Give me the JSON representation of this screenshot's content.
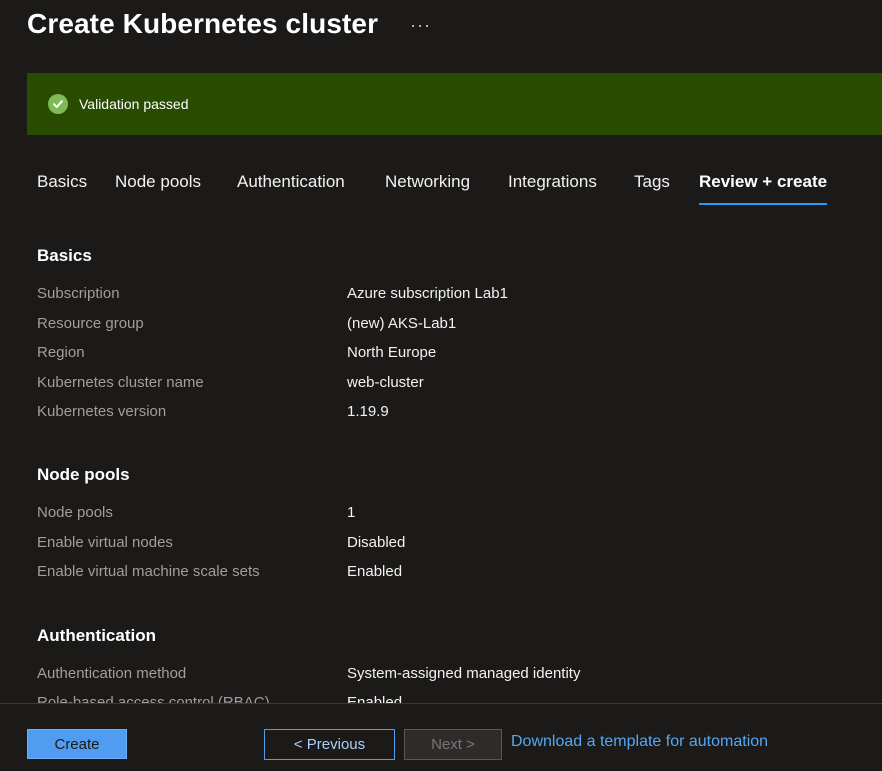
{
  "header": {
    "title": "Create Kubernetes cluster",
    "more": "···"
  },
  "validation": {
    "text": "Validation passed",
    "icon": "check-circle-icon",
    "color": "#294b02"
  },
  "tabs": [
    {
      "label": "Basics"
    },
    {
      "label": "Node pools"
    },
    {
      "label": "Authentication"
    },
    {
      "label": "Networking"
    },
    {
      "label": "Integrations"
    },
    {
      "label": "Tags"
    },
    {
      "label": "Review + create",
      "active": true
    }
  ],
  "sections": {
    "basics": {
      "title": "Basics",
      "rows": [
        {
          "label": "Subscription",
          "value": "Azure subscription Lab1"
        },
        {
          "label": "Resource group",
          "value": "(new) AKS-Lab1"
        },
        {
          "label": "Region",
          "value": "North Europe"
        },
        {
          "label": "Kubernetes cluster name",
          "value": "web-cluster"
        },
        {
          "label": "Kubernetes version",
          "value": "1.19.9"
        }
      ]
    },
    "node_pools": {
      "title": "Node pools",
      "rows": [
        {
          "label": "Node pools",
          "value": "1"
        },
        {
          "label": "Enable virtual nodes",
          "value": "Disabled"
        },
        {
          "label": "Enable virtual machine scale sets",
          "value": "Enabled"
        }
      ]
    },
    "authentication": {
      "title": "Authentication",
      "rows": [
        {
          "label": "Authentication method",
          "value": "System-assigned managed identity"
        },
        {
          "label": "Role-based access control (RBAC)",
          "value": "Enabled"
        }
      ]
    }
  },
  "footer": {
    "create_label": "Create",
    "previous_label": "< Previous",
    "next_label": "Next >",
    "download_label": "Download a template for automation"
  },
  "colors": {
    "accent": "#4f9cf1",
    "link": "#55a7f3",
    "success": "#7fba54"
  }
}
